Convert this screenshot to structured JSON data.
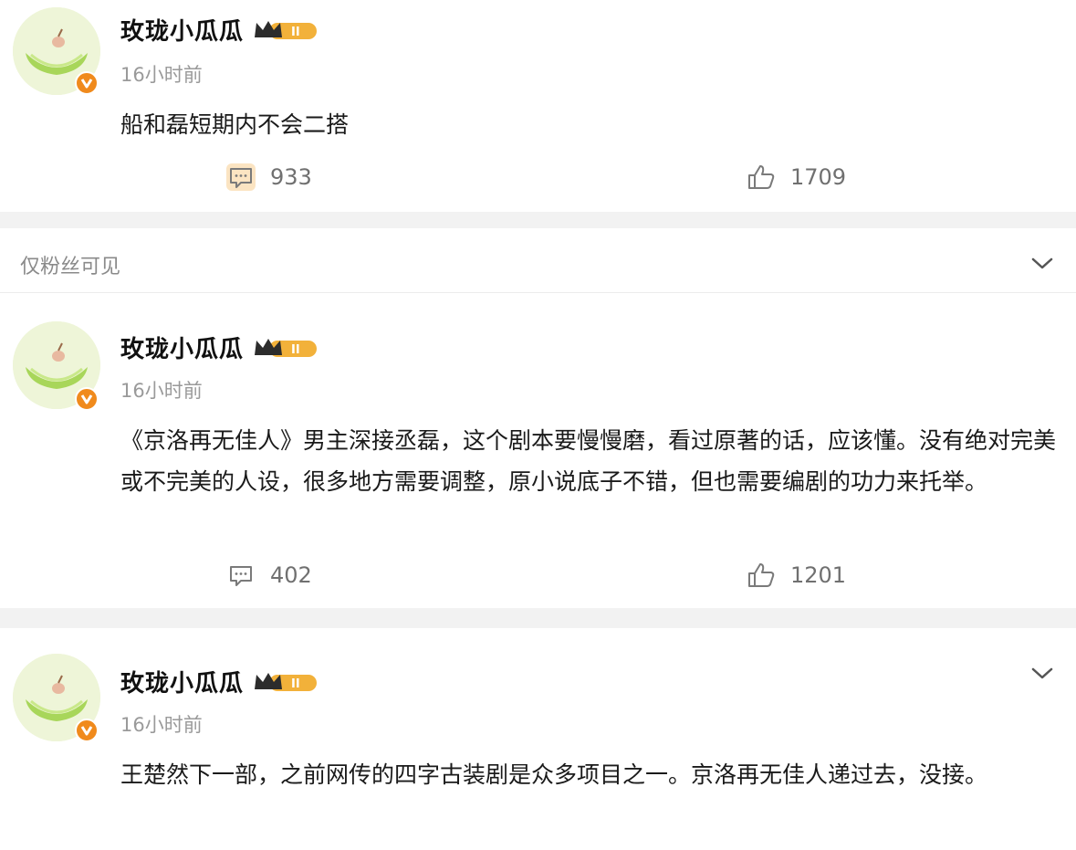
{
  "posts": [
    {
      "username": "玫珑小瓜瓜",
      "timestamp": "16小时前",
      "content": "船和磊短期内不会二搭",
      "comments": "933",
      "likes": "1709",
      "avatar_icon": "melon-avatar-icon",
      "verified_icon": "verified-v-icon",
      "level_icon": "level-crown-badge-icon"
    },
    {
      "username": "玫珑小瓜瓜",
      "timestamp": "16小时前",
      "content": "《京洛再无佳人》男主深接丞磊，这个剧本要慢慢磨，看过原著的话，应该懂。没有绝对完美或不完美的人设，很多地方需要调整，原小说底子不错，但也需要编剧的功力来托举。",
      "comments": "402",
      "likes": "1201",
      "avatar_icon": "melon-avatar-icon",
      "verified_icon": "verified-v-icon",
      "level_icon": "level-crown-badge-icon"
    },
    {
      "username": "玫珑小瓜瓜",
      "timestamp": "16小时前",
      "content": "王楚然下一部，之前网传的四字古装剧是众多项目之一。京洛再无佳人递过去，没接。",
      "avatar_icon": "melon-avatar-icon",
      "verified_icon": "verified-v-icon",
      "level_icon": "level-crown-badge-icon"
    }
  ],
  "visibility": {
    "label": "仅粉丝可见"
  },
  "icons": {
    "comment": "comment-icon",
    "like": "thumbs-up-icon",
    "expand": "chevron-down-icon"
  },
  "colors": {
    "verified_badge": "#f08a1c",
    "level_badge": "#f2b13a",
    "comment_highlight": "#f9d9a8",
    "divider": "#f2f2f2"
  }
}
